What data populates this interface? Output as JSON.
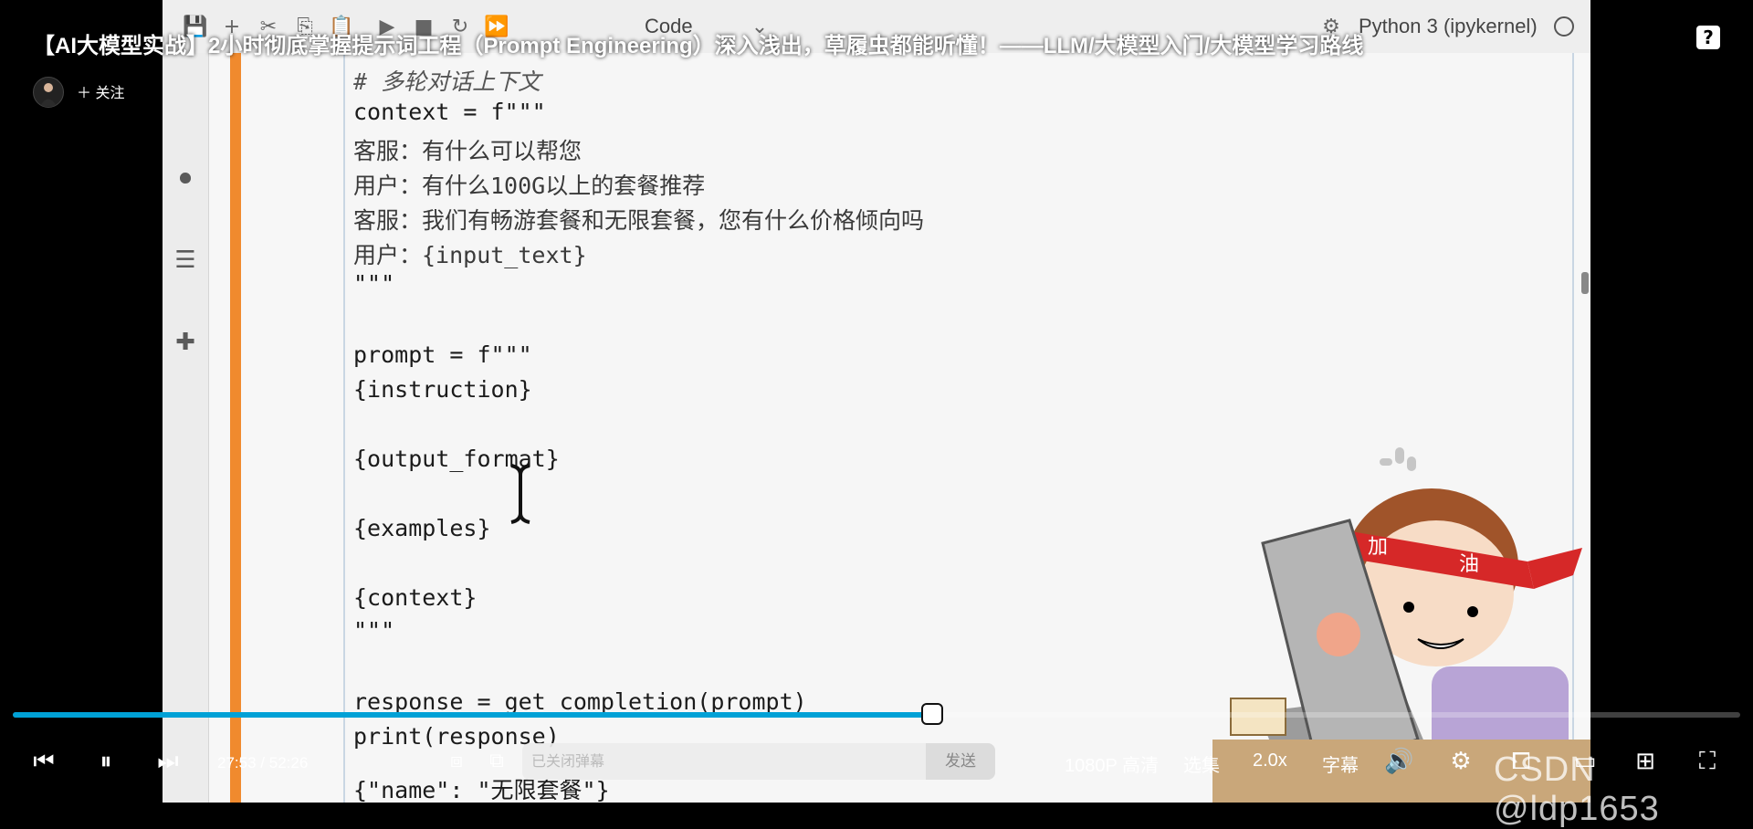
{
  "video": {
    "title": "【AI大模型实战】2小时彻底掌握提示词工程（Prompt Engineering）深入浅出，草履虫都能听懂！——LLM/大模型入门/大模型学习路线",
    "follow_label": "关注",
    "help_icon": "?"
  },
  "notebook": {
    "toolbar": {
      "cell_type": "Code",
      "kernel": "Python 3 (ipykernel)"
    },
    "code": [
      "# 多轮对话上下文",
      "context = f\"\"\"",
      "客服：有什么可以帮您",
      "用户：有什么100G以上的套餐推荐",
      "客服：我们有畅游套餐和无限套餐，您有什么价格倾向吗",
      "用户：{input_text}",
      "\"\"\"",
      "",
      "prompt = f\"\"\"",
      "{instruction}",
      "",
      "{output_format}",
      "",
      "{examples}",
      "",
      "{context}",
      "\"\"\"",
      "",
      "response = get_completion(prompt)",
      "print(response)",
      "{\"name\": \"无限套餐\"}"
    ]
  },
  "player": {
    "progress": 0.532,
    "current_time": "27:53",
    "duration": "52:26",
    "danmaku_placeholder": "已关闭弹幕",
    "send_label": "发送",
    "quality_label": "1080P 高清",
    "episodes_label": "选集",
    "speed_label": "2.0x",
    "subtitle_label": "字幕"
  },
  "watermark": "CSDN @ldp1653",
  "colors": {
    "progress": "#00a1d6",
    "cell_bar": "#f08a2e"
  }
}
